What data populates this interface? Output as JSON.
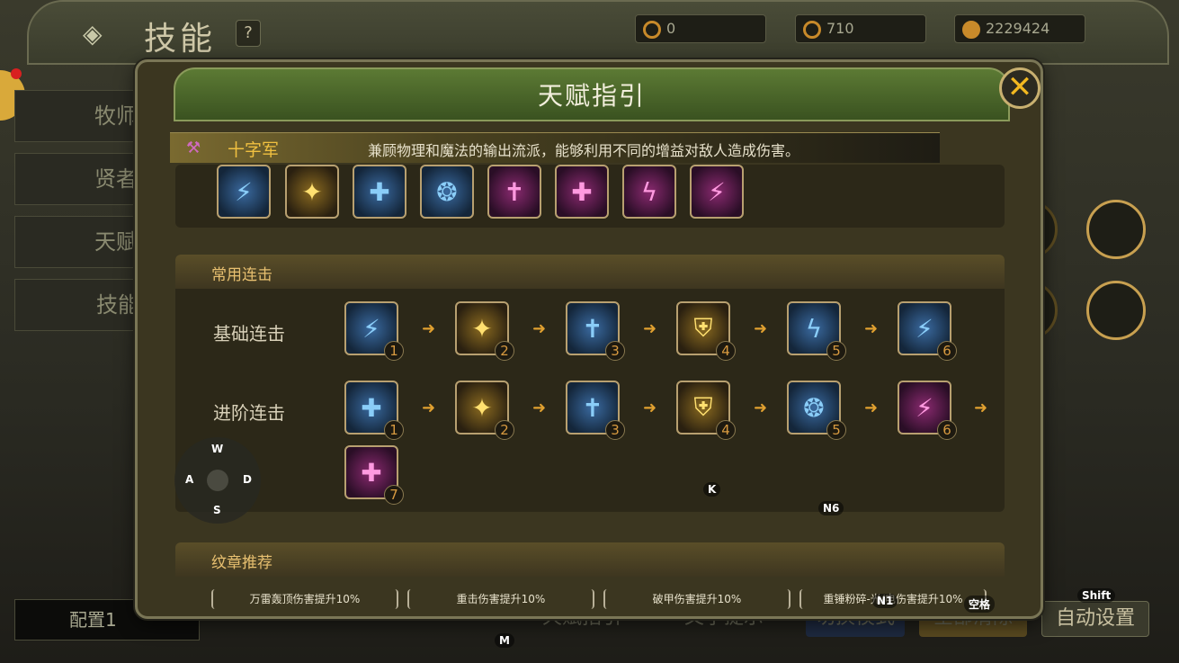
{
  "topbar": {
    "title": "技能",
    "help": "?",
    "currencies": [
      "0",
      "710",
      "2229424"
    ]
  },
  "sidebar": {
    "items": [
      "牧师",
      "贤者",
      "天赋",
      "技能配置"
    ],
    "config": "配置1"
  },
  "bottom": {
    "talent_guide": "天赋指引",
    "text_hint": "文字提示",
    "toggle_mode": "切换模式",
    "clear_all": "全部清除",
    "auto_setup": "自动设置"
  },
  "modal": {
    "title": "天赋指引",
    "close": "✕",
    "class_name": "十字军",
    "class_desc": "兼顾物理和魔法的输出流派，能够利用不同的增益对敌人造成伤害。",
    "sections": {
      "combo_title": "常用连击",
      "emblem_title": "纹章推荐"
    },
    "combos": {
      "basic_label": "基础连击",
      "advanced_label": "进阶连击",
      "basic_nums": [
        "1",
        "2",
        "3",
        "4",
        "5",
        "6"
      ],
      "advanced_nums": [
        "1",
        "2",
        "3",
        "4",
        "5",
        "6",
        "7"
      ]
    },
    "emblems": [
      "万雷轰顶伤害提升10%",
      "重击伤害提升10%",
      "破甲伤害提升10%",
      "重锤粉碎-光/电伤害提升10%"
    ]
  },
  "keys": {
    "w": "W",
    "a": "A",
    "s": "S",
    "d": "D",
    "k": "K",
    "n6": "N6",
    "n1": "N1",
    "space": "空格",
    "shift": "Shift",
    "m": "M"
  },
  "colors": {
    "accent_gold": "#f0c040",
    "blue_skill": "#8acdf8",
    "gold_skill": "#ffe070",
    "pink_skill": "#ff9ae0"
  }
}
